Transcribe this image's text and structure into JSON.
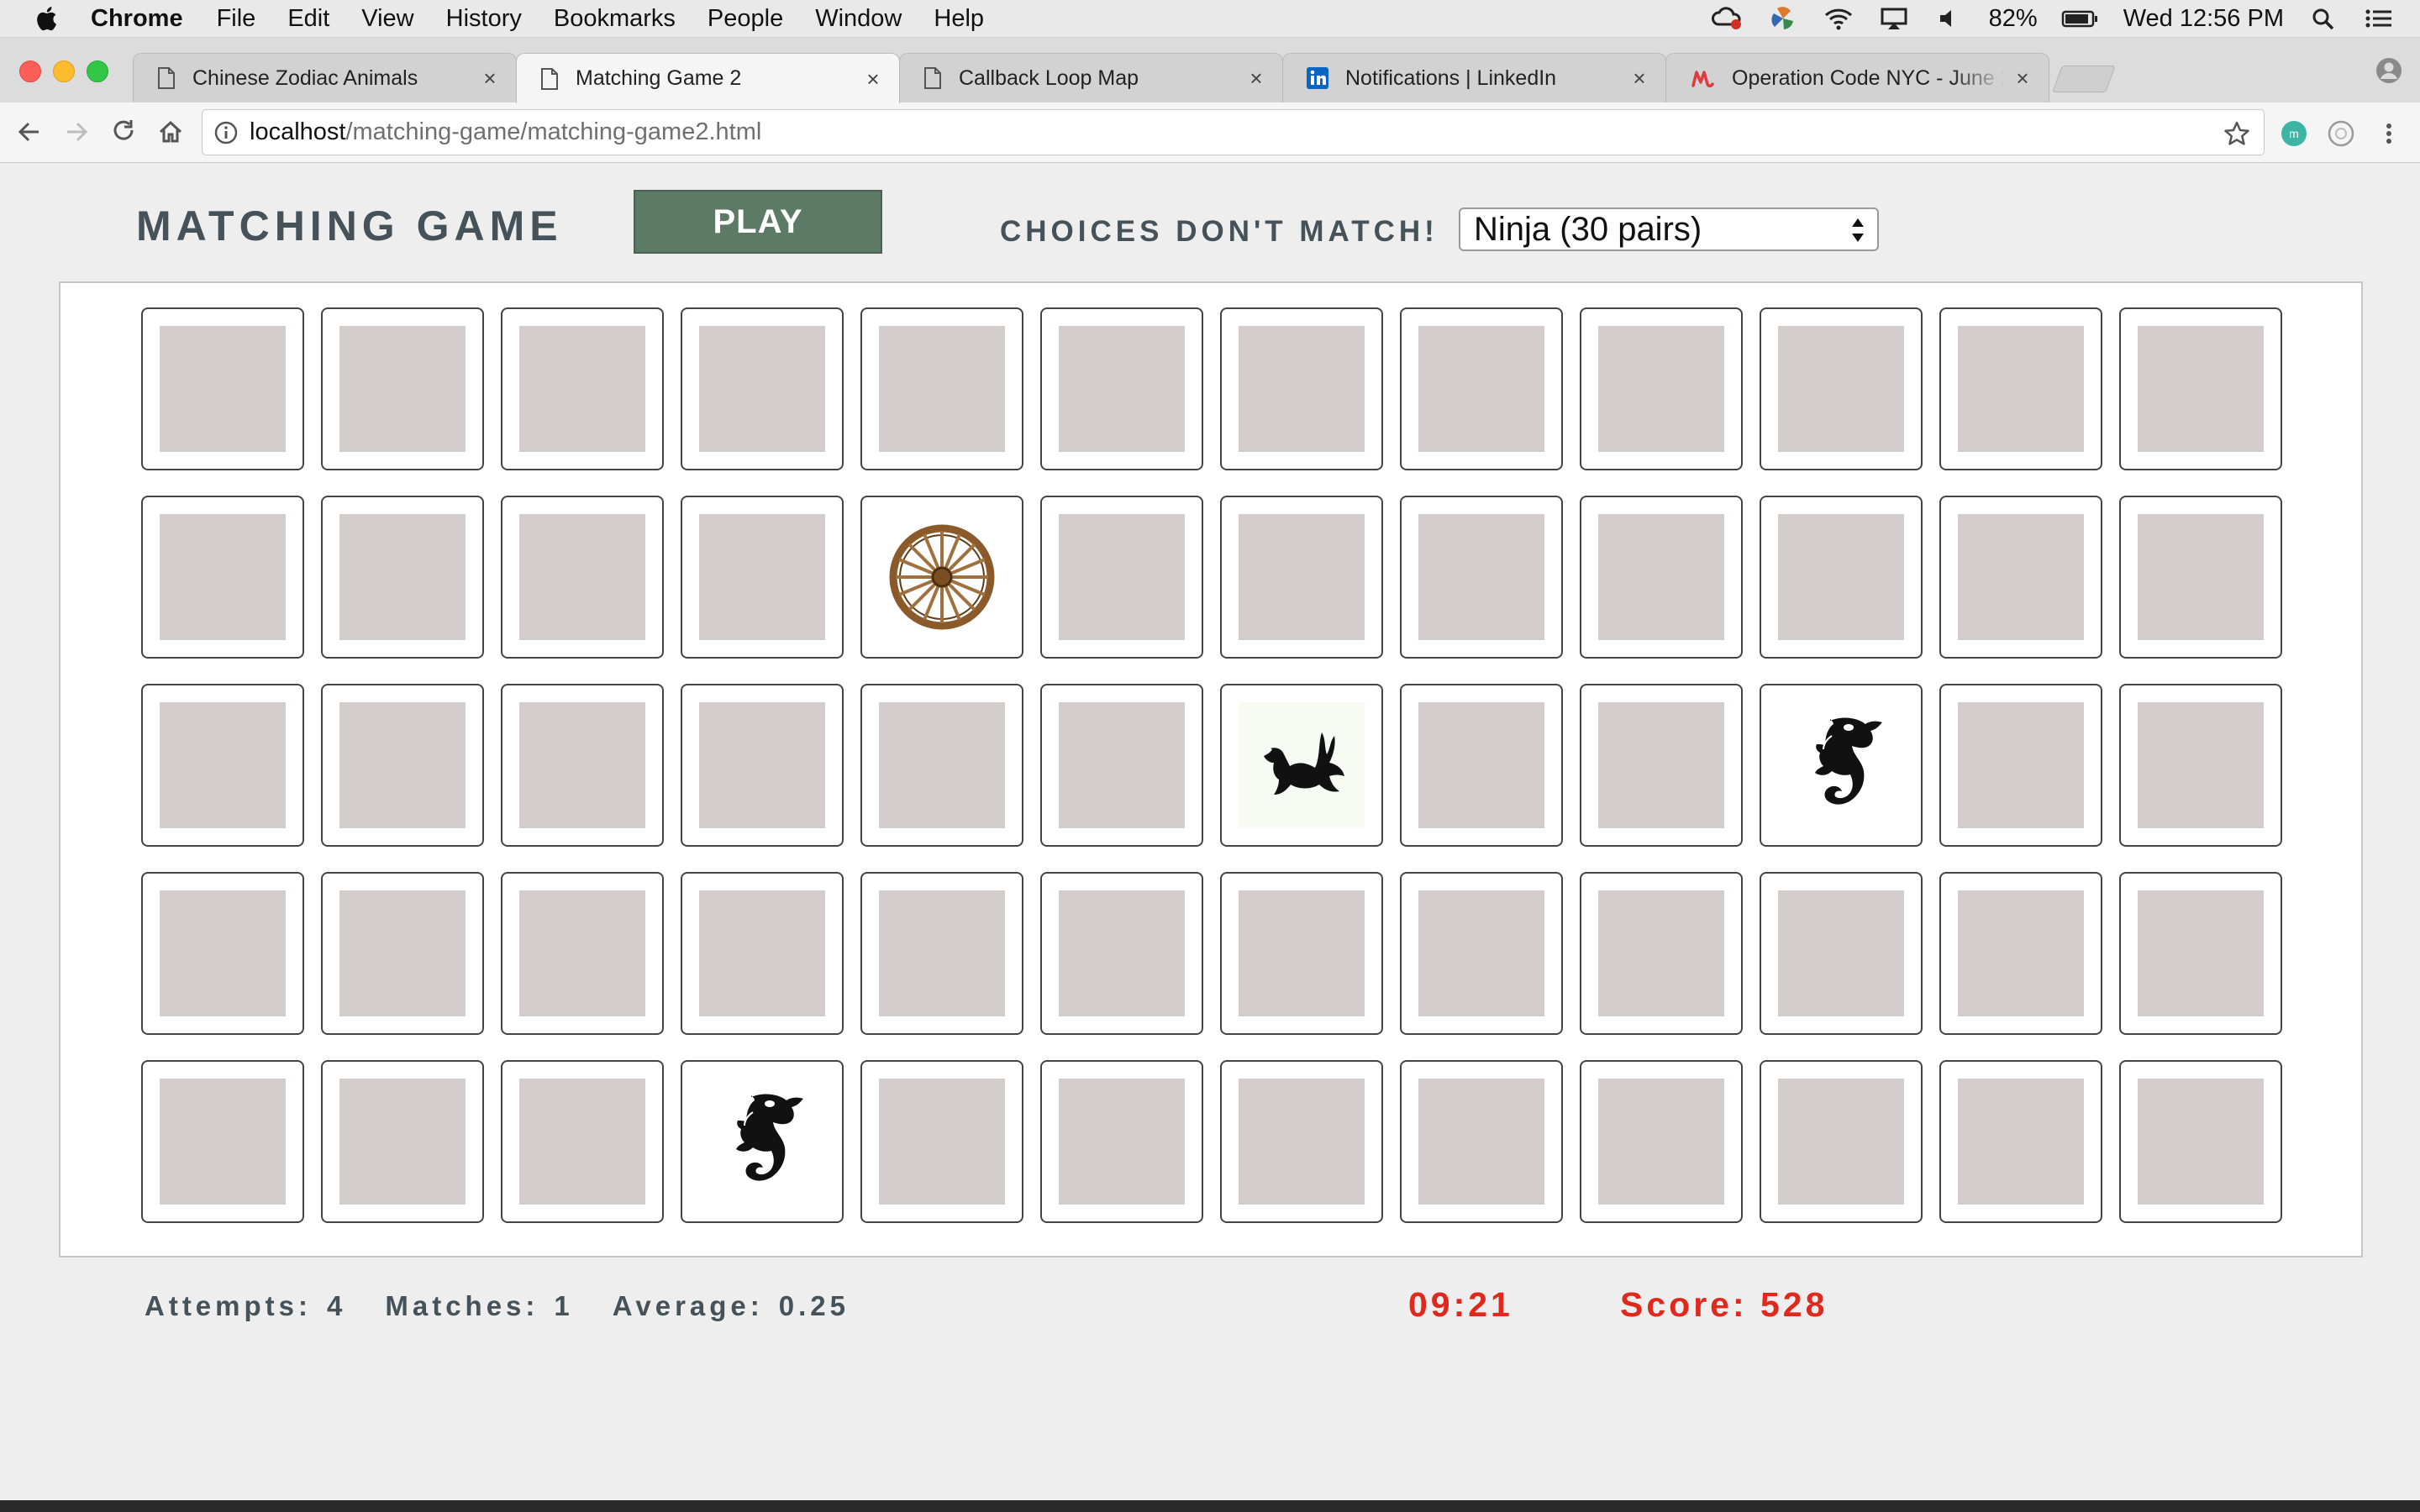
{
  "menubar": {
    "app": "Chrome",
    "items": [
      "File",
      "Edit",
      "View",
      "History",
      "Bookmarks",
      "People",
      "Window",
      "Help"
    ],
    "battery": "82%",
    "clock": "Wed 12:56 PM"
  },
  "tabs": [
    {
      "title": "Chinese Zodiac Animals",
      "icon": "page-icon",
      "active": false
    },
    {
      "title": "Matching Game 2",
      "icon": "page-icon",
      "active": true
    },
    {
      "title": "Callback Loop Map",
      "icon": "page-icon",
      "active": false
    },
    {
      "title": "Notifications | LinkedIn",
      "icon": "linkedin-icon",
      "active": false
    },
    {
      "title": "Operation Code NYC - June 20",
      "icon": "meetup-icon",
      "active": false
    }
  ],
  "address_bar": {
    "host": "localhost",
    "path": "/matching-game/matching-game2.html"
  },
  "game": {
    "title": "MATCHING GAME",
    "play_label": "PLAY",
    "message": "CHOICES DON'T MATCH!",
    "level": "Ninja (30 pairs)",
    "grid": {
      "rows": 5,
      "cols": 12
    },
    "revealed_cards": [
      {
        "row": 2,
        "col": 5,
        "image": "wagon-wheel-icon"
      },
      {
        "row": 3,
        "col": 7,
        "image": "duck-icon"
      },
      {
        "row": 3,
        "col": 10,
        "image": "seahorse-icon"
      },
      {
        "row": 5,
        "col": 4,
        "image": "seahorse-icon"
      }
    ]
  },
  "stats": {
    "attempts_label": "Attempts:",
    "attempts": "4",
    "matches_label": "Matches:",
    "matches": "1",
    "average_label": "Average:",
    "average": "0.25",
    "timer": "09:21",
    "score": "Score: 528"
  },
  "colors": {
    "play_button": "#5c7a66",
    "card_back": "#d2cccc",
    "alert_red": "#e0281c",
    "heading": "#46525a"
  }
}
